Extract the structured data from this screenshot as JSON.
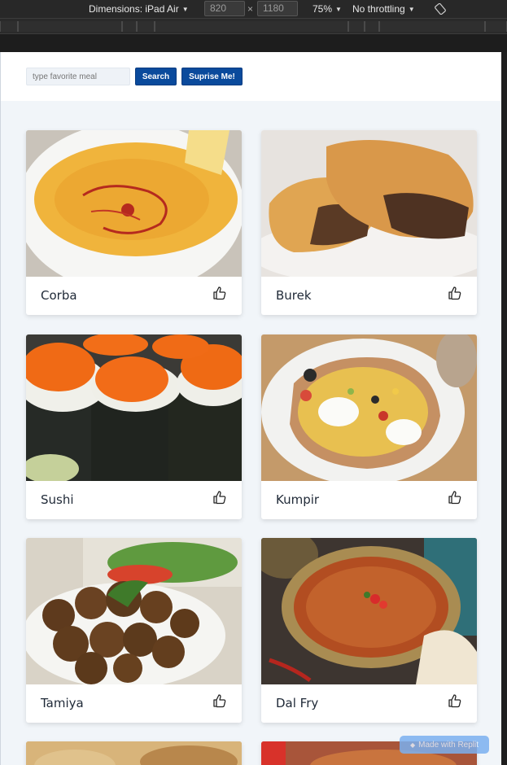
{
  "devtools": {
    "dimensions_label": "Dimensions: iPad Air",
    "width_value": "820",
    "times": "×",
    "height_value": "1180",
    "zoom": "75%",
    "throttling": "No throttling",
    "rotate_icon": "rotate-icon"
  },
  "search": {
    "placeholder": "type favorite meal",
    "search_button": "Search",
    "surprise_button": "Suprise Me!"
  },
  "meals": [
    {
      "name": "Corba"
    },
    {
      "name": "Burek"
    },
    {
      "name": "Sushi"
    },
    {
      "name": "Kumpir"
    },
    {
      "name": "Tamiya"
    },
    {
      "name": "Dal Fry"
    }
  ],
  "watermark": "Made with Replit",
  "colors": {
    "button": "#0a4a9c",
    "background": "#f1f5f9"
  }
}
